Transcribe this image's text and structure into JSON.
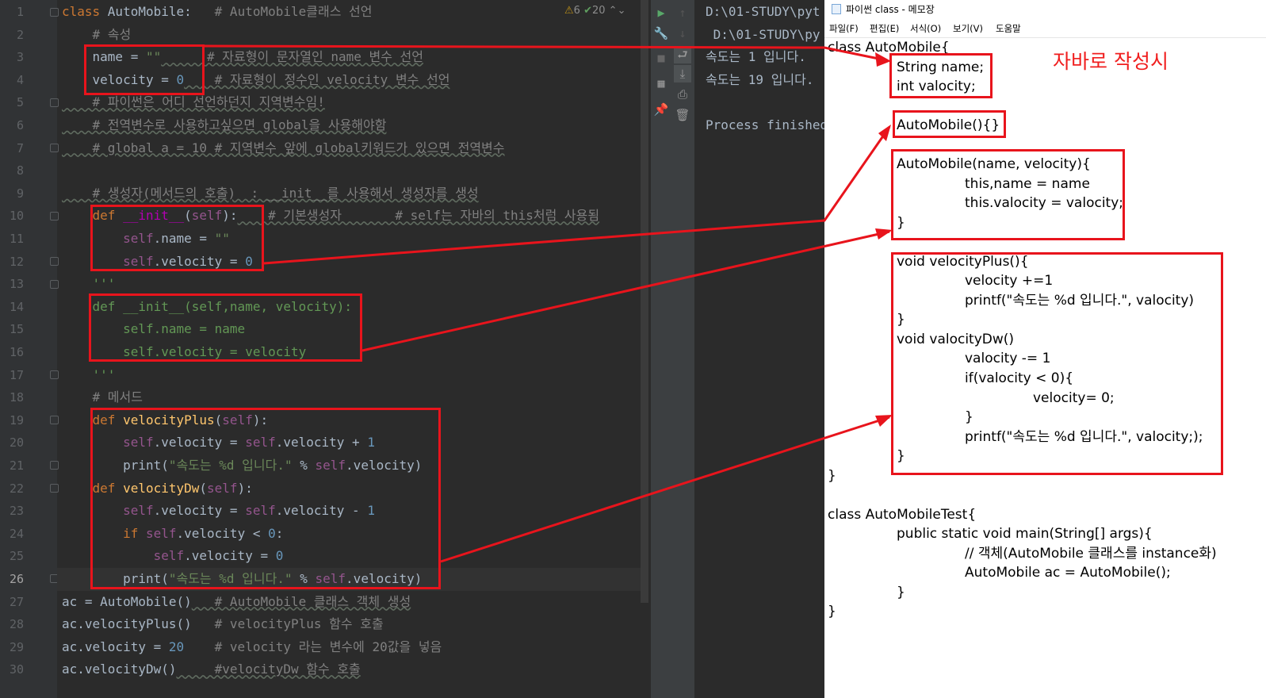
{
  "ide": {
    "inspection": {
      "warnings": "6",
      "weak_warnings": "20"
    },
    "lines": [
      {
        "n": "1"
      },
      {
        "n": "2"
      },
      {
        "n": "3"
      },
      {
        "n": "4"
      },
      {
        "n": "5"
      },
      {
        "n": "6"
      },
      {
        "n": "7"
      },
      {
        "n": "8"
      },
      {
        "n": "9"
      },
      {
        "n": "10"
      },
      {
        "n": "11"
      },
      {
        "n": "12"
      },
      {
        "n": "13"
      },
      {
        "n": "14"
      },
      {
        "n": "15"
      },
      {
        "n": "16"
      },
      {
        "n": "17"
      },
      {
        "n": "18"
      },
      {
        "n": "19"
      },
      {
        "n": "20"
      },
      {
        "n": "21"
      },
      {
        "n": "22"
      },
      {
        "n": "23"
      },
      {
        "n": "24"
      },
      {
        "n": "25"
      },
      {
        "n": "26"
      },
      {
        "n": "27"
      },
      {
        "n": "28"
      },
      {
        "n": "29"
      },
      {
        "n": "30"
      }
    ],
    "code": {
      "l1_kw": "class ",
      "l1_name": "AutoMobile:",
      "l1_cm": "   # AutoMobile클래스 선언",
      "l2_cm": "    # 속성",
      "l3_a": "    name = ",
      "l3_str": "\"\"",
      "l3_cm": "      # 자료형이 문자열인 name 변수 선언",
      "l4_a": "    velocity = ",
      "l4_num": "0",
      "l4_cm": "    # 자료형이 정수인 velocity 변수 선언",
      "l5_cm": "    # 파이썬은 어디 선언하던지 지역변수임!",
      "l6_cm": "    # 전역변수로 사용하고싶으면 global을 사용해야함",
      "l7_cm": "    # global a = 10 # 지역변수 앞에 global키워드가 있으면 전역변수",
      "l9_cm": "    # 생성자(메서드의 호출)  : __init__를 사용해서 생성자를 생성",
      "l10_def": "    def ",
      "l10_fn": "__init__",
      "l10_p1": "(",
      "l10_self": "self",
      "l10_p2": "):",
      "l10_cm": "    # 기본생성자       # self는 자바의 this처럼 사용됨",
      "l11_self": "        self",
      "l11_a": ".name = ",
      "l11_str": "\"\"",
      "l12_self": "        self",
      "l12_a": ".velocity = ",
      "l12_num": "0",
      "l13": "    '''",
      "l14": "    def __init__(self,name, velocity):",
      "l15": "        self.name = name",
      "l16": "        self.velocity = velocity",
      "l17": "    '''",
      "l18_cm": "    # 메서드",
      "l19_def": "    def ",
      "l19_fn": "velocityPlus",
      "l19_p1": "(",
      "l19_self": "self",
      "l19_p2": "):",
      "l20_self": "        self",
      "l20_a": ".velocity = ",
      "l20_self2": "self",
      "l20_b": ".velocity + ",
      "l20_num": "1",
      "l21_a": "        print(",
      "l21_str": "\"속도는 %d 입니다.\"",
      "l21_b": " % ",
      "l21_self": "self",
      "l21_c": ".velocity)",
      "l22_def": "    def ",
      "l22_fn": "velocityDw",
      "l22_p1": "(",
      "l22_self": "self",
      "l22_p2": "):",
      "l23_self": "        self",
      "l23_a": ".velocity = ",
      "l23_self2": "self",
      "l23_b": ".velocity - ",
      "l23_num": "1",
      "l24_if": "        if ",
      "l24_self": "self",
      "l24_a": ".velocity < ",
      "l24_num": "0",
      "l24_b": ":",
      "l25_self": "            self",
      "l25_a": ".velocity = ",
      "l25_num": "0",
      "l26_a": "        print(",
      "l26_str": "\"속도는 %d 입니다.\"",
      "l26_b": " % ",
      "l26_self": "self",
      "l26_c": ".velocity)",
      "l27_a": "ac = AutoMobile()",
      "l27_cm": "   # AutoMobile 클래스 객체 생성",
      "l28_a": "ac.velocityPlus()",
      "l28_cm": "   # velocityPlus 함수 호출",
      "l29_a": "ac.velocity = ",
      "l29_num": "20",
      "l29_cm": "    # velocity 라는 변수에 20값을 넣음",
      "l30_a": "ac.velocityDw()",
      "l30_cm": "     #velocityDw 함수 호출"
    }
  },
  "console": {
    "lines": [
      "D:\\01-STUDY\\pyt",
      " D:\\01-STUDY\\py",
      "속도는 1 입니다.",
      "속도는 19 입니다.",
      "",
      "Process finished"
    ]
  },
  "notepad": {
    "title": "파이썬 class - 메모장",
    "menu": [
      "파일(F)",
      "편집(E)",
      "서식(O)",
      "보기(V)",
      "도움말"
    ],
    "java_title": "자바로 작성시",
    "lines": [
      "class AutoMobile{",
      "String name;",
      "int valocity;",
      "AutoMobile(){}",
      "AutoMobile(name, velocity){",
      "this,name = name",
      "this.valocity = valocity;",
      "}",
      "void velocityPlus(){",
      "velocity +=1",
      "printf(\"속도는 %d 입니다.\", valocity)",
      "}",
      "void valocityDw()",
      "valocity -= 1",
      "if(valocity < 0){",
      "velocity= 0;",
      "}",
      "printf(\"속도는 %d 입니다.\", valocity;);",
      "}",
      "}",
      "class AutoMobileTest{",
      "public static void main(String[] args){",
      "// 객체(AutoMobile 클래스를 instance화)",
      "AutoMobile ac = AutoMobile();",
      "}",
      "}"
    ]
  },
  "colors": {
    "annotation_red": "#e8141c",
    "editor_bg": "#2b2b2b"
  }
}
